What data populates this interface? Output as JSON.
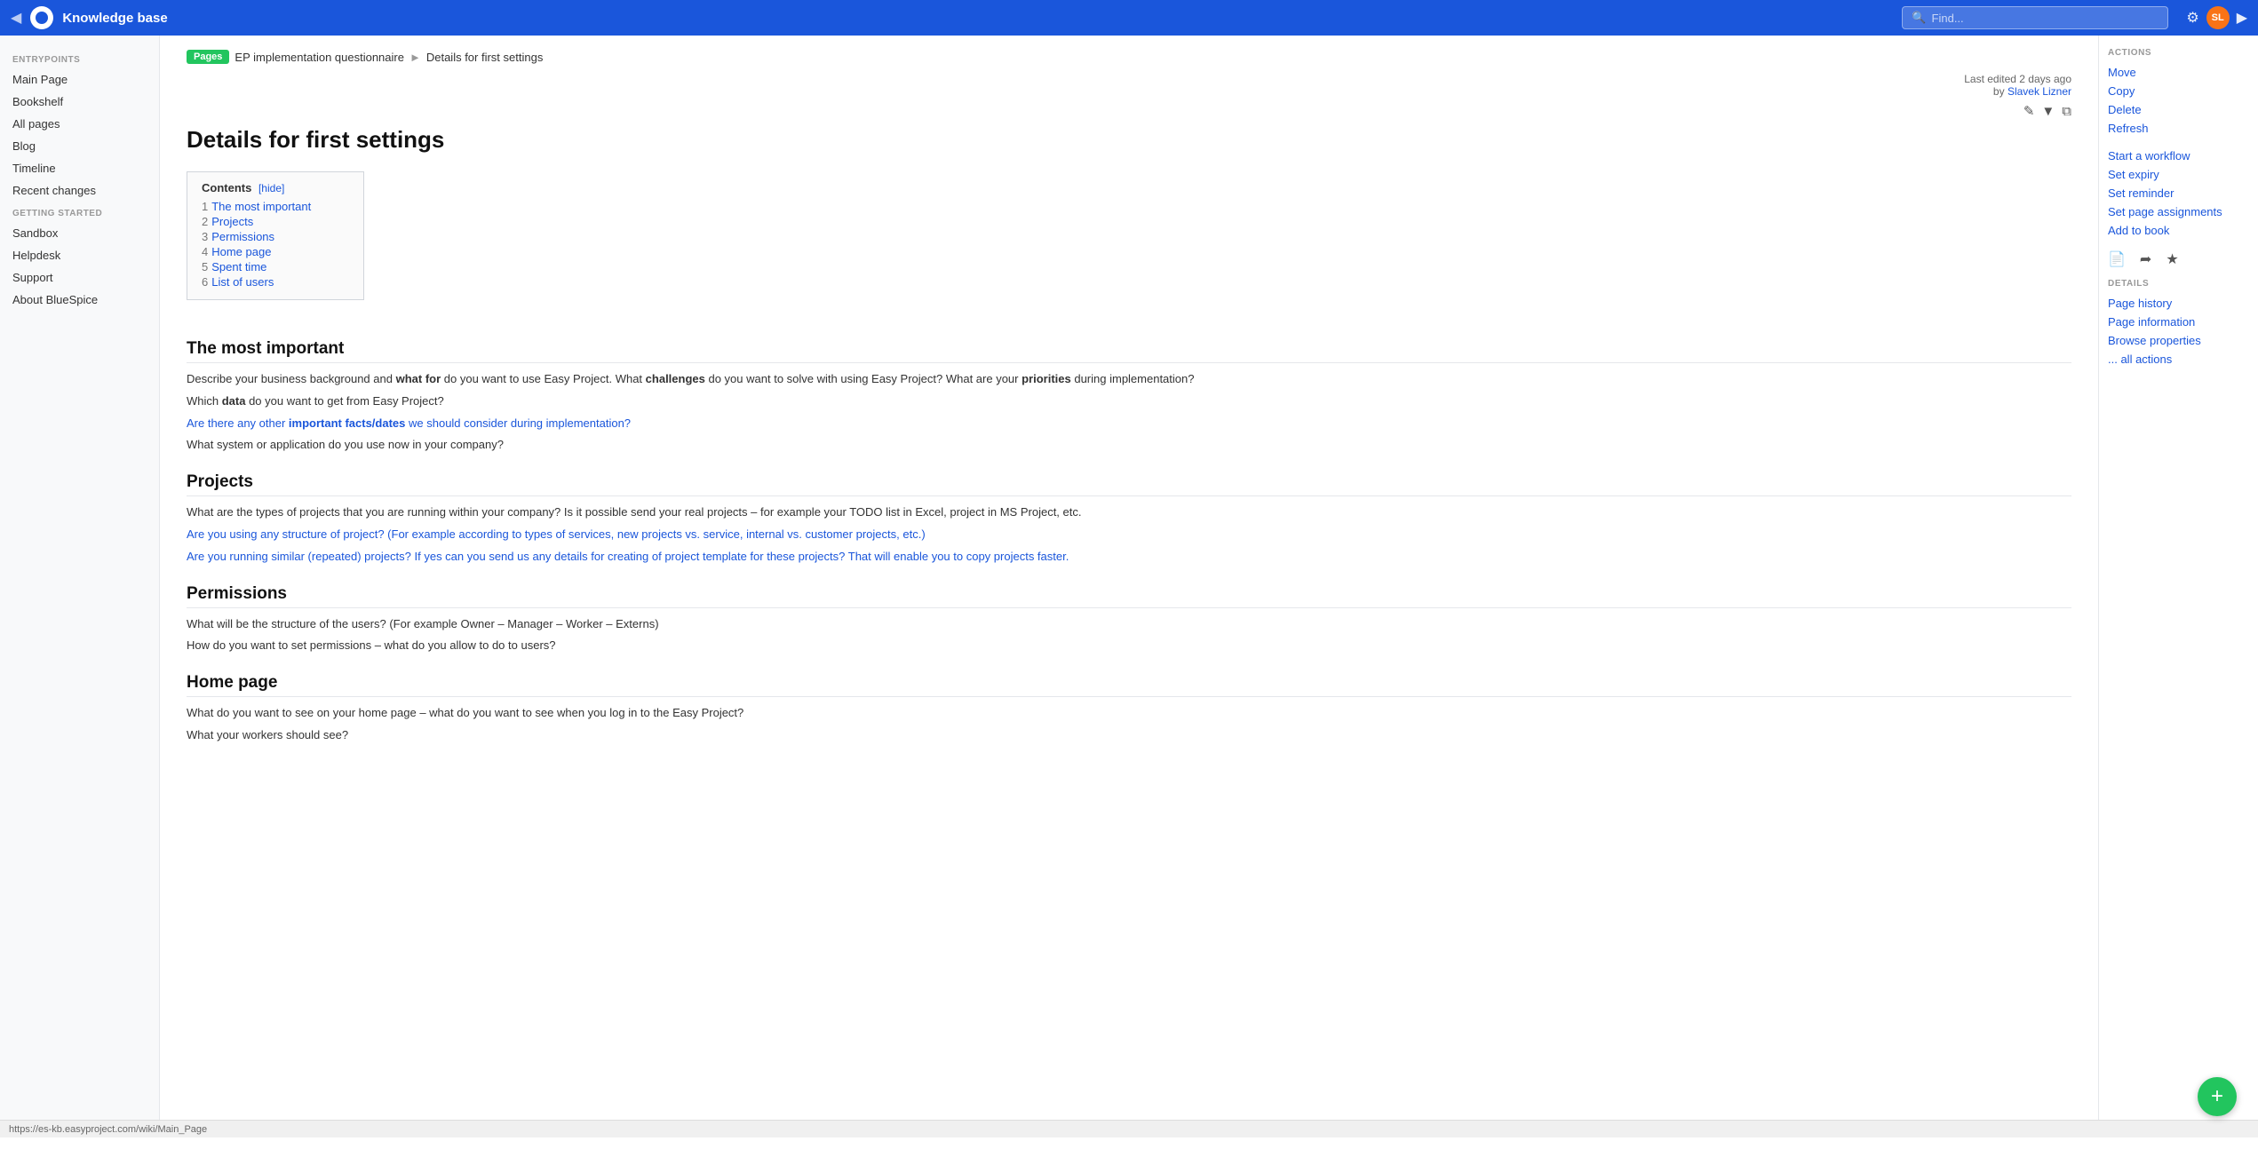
{
  "topbar": {
    "app_title": "Knowledge base",
    "search_placeholder": "Find...",
    "nav_back": "◀",
    "nav_forward": "▶"
  },
  "sidebar": {
    "section_entrypoints": "ENTRYPOINTS",
    "section_getting_started": "GETTING STARTED",
    "items_entry": [
      {
        "label": "Main Page"
      },
      {
        "label": "Bookshelf"
      },
      {
        "label": "All pages"
      },
      {
        "label": "Blog"
      },
      {
        "label": "Timeline"
      },
      {
        "label": "Recent changes"
      }
    ],
    "items_gs": [
      {
        "label": "Sandbox"
      },
      {
        "label": "Helpdesk"
      },
      {
        "label": "Support"
      },
      {
        "label": "About BlueSpice"
      }
    ]
  },
  "breadcrumb": {
    "pages_badge": "Pages",
    "parent_page": "EP implementation questionnaire",
    "sep": "▶",
    "current_page": "Details for first settings"
  },
  "page_header": {
    "edit_info": "Last edited 2 days ago",
    "by_label": "by",
    "editor": "Slavek Lizner",
    "page_title": "Details for first settings"
  },
  "contents": {
    "title": "Contents",
    "hide_label": "[hide]",
    "items": [
      {
        "num": "1",
        "label": "The most important"
      },
      {
        "num": "2",
        "label": "Projects"
      },
      {
        "num": "3",
        "label": "Permissions"
      },
      {
        "num": "4",
        "label": "Home page"
      },
      {
        "num": "5",
        "label": "Spent time"
      },
      {
        "num": "6",
        "label": "List of users"
      }
    ]
  },
  "sections": [
    {
      "id": "most-important",
      "title": "The most important",
      "paragraphs": [
        "Describe your business background and <b>what for</b> do you want to use Easy Project. What <b>challenges</b> do you want to solve with using Easy Project? What are your <b>priorities</b> during implementation?",
        "Which <b>data</b> do you want to get from Easy Project?",
        "Are there any other <b>important facts/dates</b> we should consider during implementation?",
        "What system or application do you use now in your company?"
      ]
    },
    {
      "id": "projects",
      "title": "Projects",
      "paragraphs": [
        "What are the types of projects that you are running within your company? Is it possible send your real projects – for example your TODO list in Excel, project in MS Project, etc.",
        "Are you using any structure of project? (For example according to types of services, new projects vs. service, internal vs. customer projects, etc.)",
        "Are you running similar (repeated) projects? If yes can you send us any details for creating of project template for these projects? That will enable you to copy projects faster."
      ]
    },
    {
      "id": "permissions",
      "title": "Permissions",
      "paragraphs": [
        "What will be the structure of the users? (For example Owner – Manager – Worker – Externs)",
        "How do you want to set permissions – what do you allow to do to users?"
      ]
    },
    {
      "id": "home-page",
      "title": "Home page",
      "paragraphs": [
        "What do you want to see on your home page – what do you want to see when you log in to the Easy Project?",
        "What your workers should see?"
      ]
    }
  ],
  "right_sidebar": {
    "actions_title": "ACTIONS",
    "action_items": [
      {
        "label": "Move"
      },
      {
        "label": "Copy"
      },
      {
        "label": "Delete"
      },
      {
        "label": "Refresh"
      }
    ],
    "action_items2": [
      {
        "label": "Start a workflow"
      },
      {
        "label": "Set expiry"
      },
      {
        "label": "Set reminder"
      },
      {
        "label": "Set page assignments"
      },
      {
        "label": "Add to book"
      }
    ],
    "details_title": "DETAILS",
    "details_items": [
      {
        "label": "Page history"
      },
      {
        "label": "Page information"
      },
      {
        "label": "Browse properties"
      },
      {
        "label": "... all actions"
      }
    ]
  },
  "statusbar": {
    "url": "https://es-kb.easyproject.com/wiki/Main_Page"
  },
  "fab": {
    "icon": "+"
  }
}
